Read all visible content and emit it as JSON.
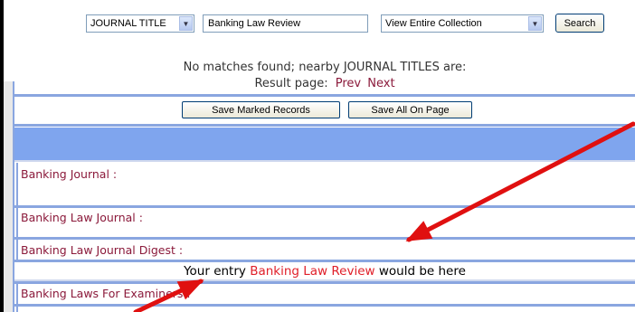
{
  "search": {
    "index_select": "JOURNAL TITLE",
    "query_value": "Banking Law Review",
    "collection_select": "View Entire Collection",
    "search_button": "Search"
  },
  "results": {
    "no_match_message": "No matches found; nearby JOURNAL TITLES are:",
    "result_page_label": "Result page:",
    "prev_link": "Prev",
    "next_link": "Next",
    "save_marked_button": "Save Marked Records",
    "save_all_button": "Save All On Page",
    "items": [
      "Banking Journal :",
      "Banking Law Journal :",
      "Banking Law Journal Digest :",
      "Banking Laws For Examiners :"
    ],
    "entry_prefix": "Your entry",
    "entry_highlight": "Banking Law Review",
    "entry_suffix": "would be here"
  },
  "annotations": {
    "arrow_color": "#e01010"
  }
}
